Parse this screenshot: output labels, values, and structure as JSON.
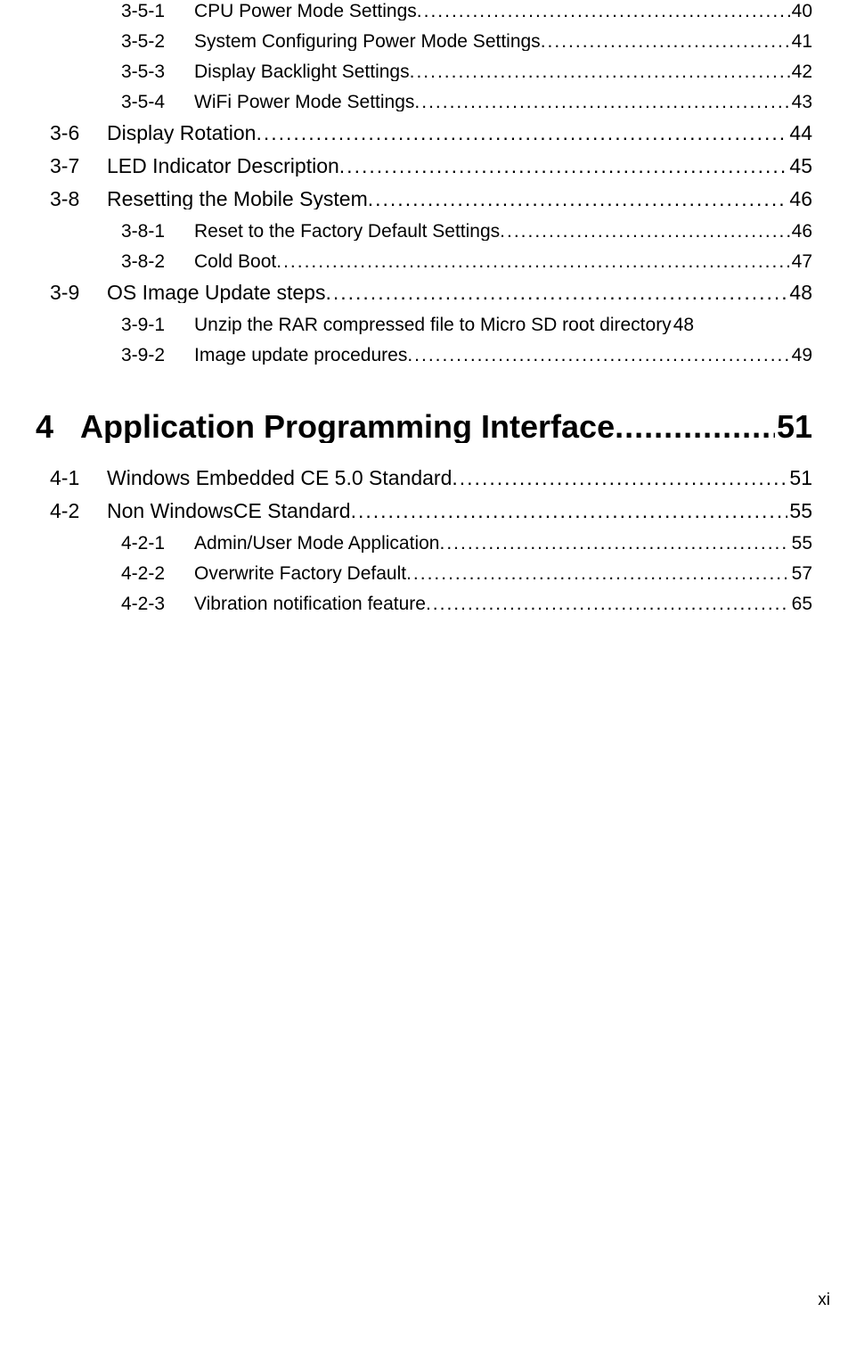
{
  "toc": [
    {
      "level": 3,
      "num": "3-5-1",
      "title": "CPU Power Mode Settings",
      "page": "40",
      "dots": true
    },
    {
      "level": 3,
      "num": "3-5-2",
      "title": "System Configuring Power Mode Settings",
      "page": "41",
      "dots": true
    },
    {
      "level": 3,
      "num": "3-5-3",
      "title": "Display Backlight Settings",
      "page": "42",
      "dots": true
    },
    {
      "level": 3,
      "num": "3-5-4",
      "title": "WiFi Power Mode Settings",
      "page": "43",
      "dots": true
    },
    {
      "level": 2,
      "num": "3-6",
      "title": "Display Rotation",
      "page": "44",
      "dots": true
    },
    {
      "level": 2,
      "num": "3-7",
      "title": "LED Indicator Description",
      "page": "45",
      "dots": true
    },
    {
      "level": 2,
      "num": "3-8",
      "title": "Resetting the Mobile System",
      "page": "46",
      "dots": true
    },
    {
      "level": 3,
      "num": "3-8-1",
      "title": "Reset to the Factory Default Settings",
      "page": "46",
      "dots": true
    },
    {
      "level": 3,
      "num": "3-8-2",
      "title": "Cold Boot",
      "page": "47",
      "dots": true
    },
    {
      "level": 2,
      "num": "3-9",
      "title": "OS Image Update steps",
      "page": "48",
      "dots": true
    },
    {
      "level": 3,
      "num": "3-9-1",
      "title": "Unzip the RAR compressed file to Micro SD root directory",
      "page": "48",
      "dots": false
    },
    {
      "level": 3,
      "num": "3-9-2",
      "title": "Image update procedures",
      "page": "49",
      "dots": true
    },
    {
      "level": 1,
      "num": "4",
      "title": "Application Programming Interface",
      "page": "51",
      "dots": true
    },
    {
      "level": 2,
      "num": "4-1",
      "title": "Windows Embedded CE 5.0 Standard",
      "page": "51",
      "dots": true
    },
    {
      "level": 2,
      "num": "4-2",
      "title": "Non WindowsCE Standard",
      "page": "55",
      "dots": true
    },
    {
      "level": 3,
      "num": "4-2-1",
      "title": "Admin/User Mode Application",
      "page": "55",
      "dots": true
    },
    {
      "level": 3,
      "num": "4-2-2",
      "title": "Overwrite Factory Default",
      "page": "57",
      "dots": true
    },
    {
      "level": 3,
      "num": "4-2-3",
      "title": "Vibration notification feature",
      "page": "65",
      "dots": true
    }
  ],
  "footer": "xi",
  "dotfill": "..............................................................................................................................."
}
